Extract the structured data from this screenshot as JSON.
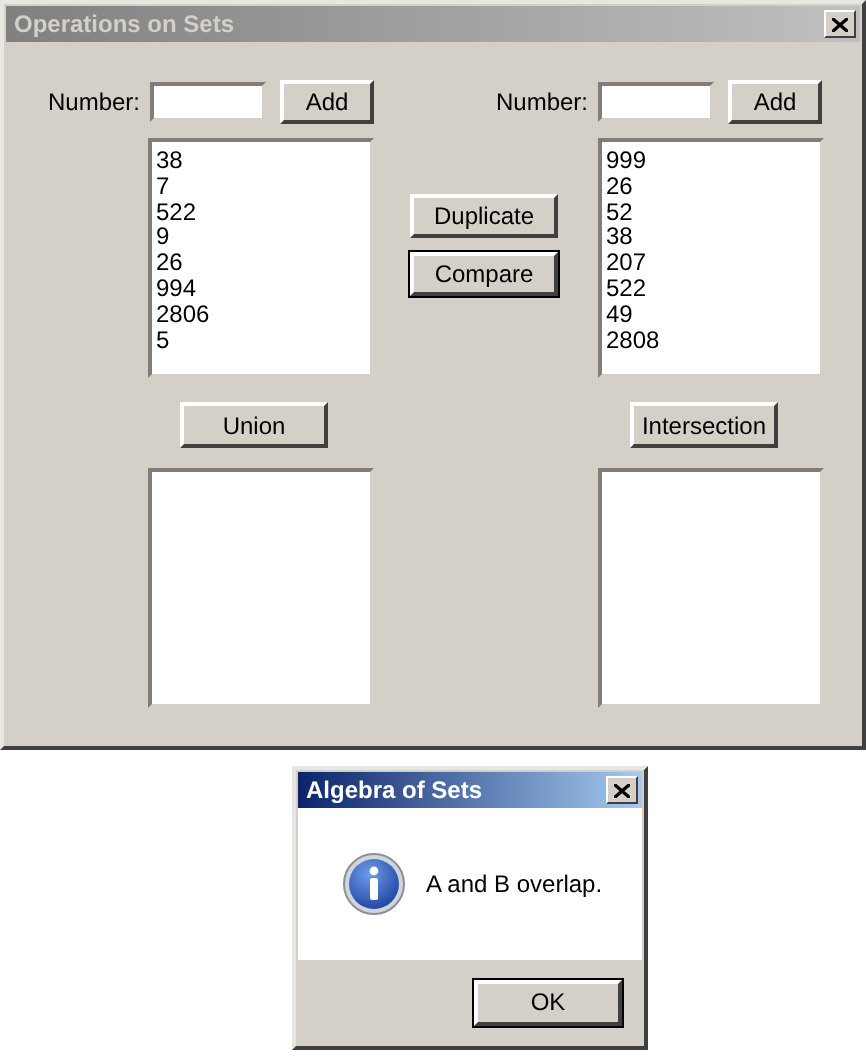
{
  "main_window": {
    "title": "Operations on Sets",
    "active": false
  },
  "set_a": {
    "number_label": "Number:",
    "add_button": {
      "label": "Add",
      "default": false
    },
    "items": [
      "38",
      "7",
      "522",
      "9",
      "26",
      "994",
      "2806",
      "5"
    ]
  },
  "set_b": {
    "number_label": "Number:",
    "add_button": {
      "label": "Add",
      "default": false
    },
    "items": [
      "999",
      "26",
      "52",
      "38",
      "207",
      "522",
      "49",
      "2808"
    ]
  },
  "actions": [
    {
      "label": "Duplicate",
      "default": false
    },
    {
      "label": "Compare",
      "default": true
    }
  ],
  "union_button": {
    "label": "Union",
    "default": false
  },
  "intersection_button": {
    "label": "Intersection",
    "default": false
  },
  "dialog": {
    "title": "Algebra of Sets",
    "active": true,
    "message": "A and B overlap.",
    "button": {
      "label": "OK",
      "default": true
    }
  }
}
